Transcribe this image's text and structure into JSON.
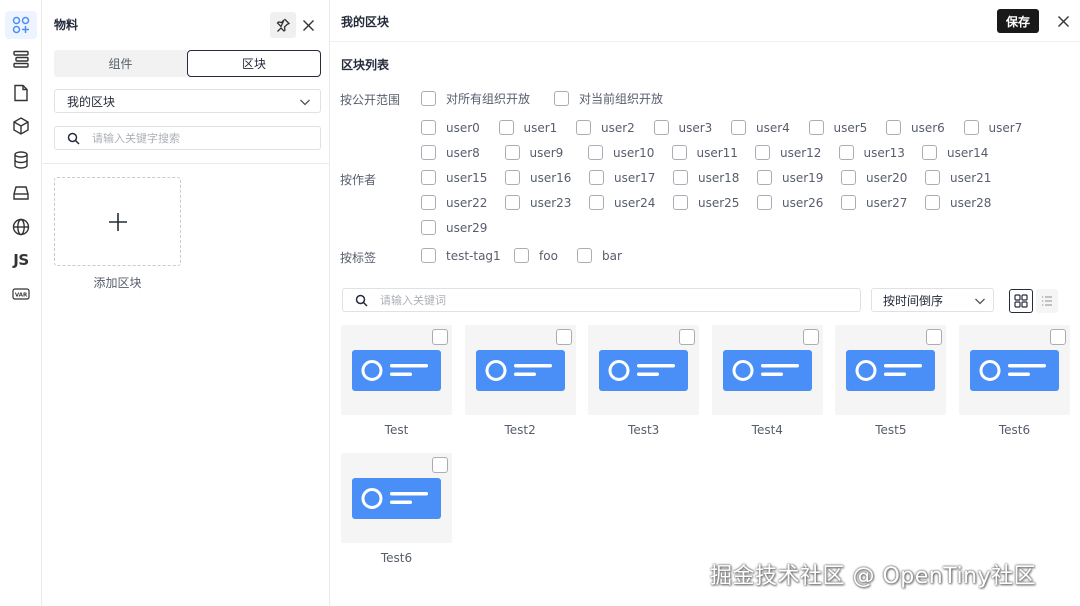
{
  "rail": {
    "items": [
      {
        "icon": "components-icon",
        "active": true
      },
      {
        "icon": "layers-icon"
      },
      {
        "icon": "page-icon"
      },
      {
        "icon": "block-cube-icon"
      },
      {
        "icon": "database-icon"
      },
      {
        "icon": "storage-icon"
      },
      {
        "icon": "globe-icon"
      },
      {
        "icon": "js-icon",
        "text": "JS"
      },
      {
        "icon": "var-icon",
        "text": "VAR"
      }
    ]
  },
  "panel": {
    "title": "物料",
    "tabs": [
      "组件",
      "区块"
    ],
    "active_tab": "区块",
    "group_select": "我的区块",
    "search_placeholder": "请输入关键字搜索",
    "add_block_label": "添加区块"
  },
  "main": {
    "title": "我的区块",
    "save_label": "保存",
    "section_title": "区块列表",
    "filters": {
      "scope_label": "按公开范围",
      "scope_options": [
        "对所有组织开放",
        "对当前组织开放"
      ],
      "author_label": "按作者",
      "authors": [
        "user0",
        "user1",
        "user2",
        "user3",
        "user4",
        "user5",
        "user6",
        "user7",
        "user8",
        "user9",
        "user10",
        "user11",
        "user12",
        "user13",
        "user14",
        "user15",
        "user16",
        "user17",
        "user18",
        "user19",
        "user20",
        "user21",
        "user22",
        "user23",
        "user24",
        "user25",
        "user26",
        "user27",
        "user28",
        "user29"
      ],
      "tag_label": "按标签",
      "tags": [
        "test-tag1",
        "foo",
        "bar"
      ]
    },
    "keyword_placeholder": "请输入关键词",
    "sort_label": "按时间倒序",
    "blocks": [
      "Test",
      "Test2",
      "Test3",
      "Test4",
      "Test5",
      "Test6",
      "Test6"
    ]
  },
  "colors": {
    "accent_blue": "#4a8ff7",
    "save_bg": "#191919"
  },
  "watermark": "掘金技术社区 @ OpenTiny社区"
}
